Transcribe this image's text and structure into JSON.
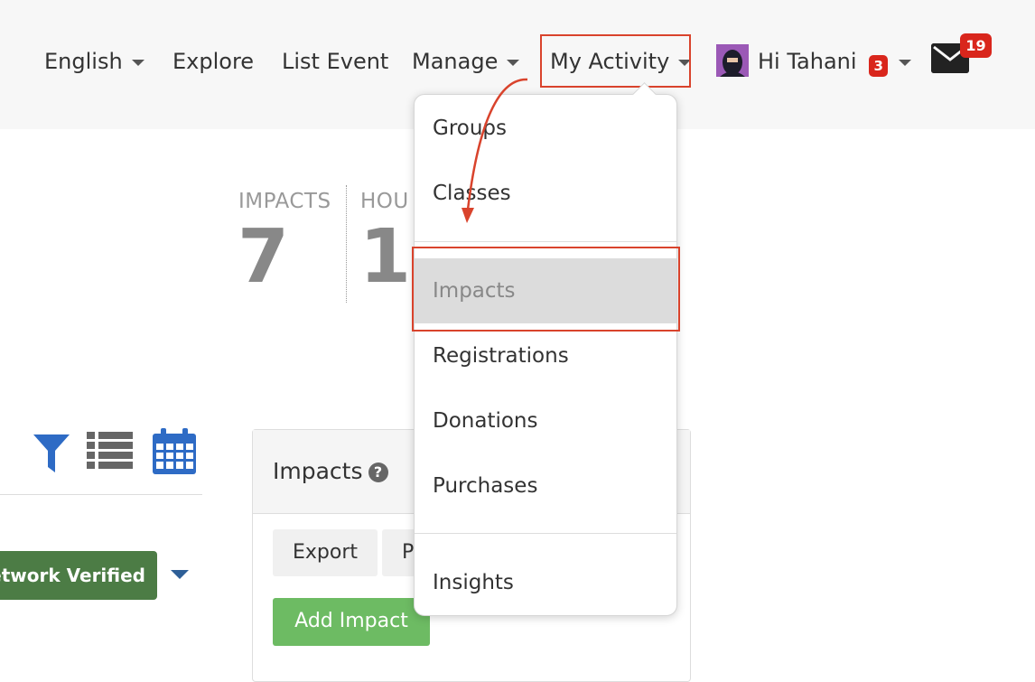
{
  "nav": {
    "language": "English",
    "explore": "Explore",
    "list_event": "List Event",
    "manage": "Manage",
    "my_activity": "My Activity",
    "greeting": "Hi Tahani",
    "greeting_badge": "3",
    "mail_badge": "19"
  },
  "stats": [
    {
      "label": "IMPACTS",
      "value": "7"
    },
    {
      "label": "HOU",
      "value": "1"
    }
  ],
  "filters": {
    "verified_label": "Network Verified"
  },
  "panel": {
    "title": "Impacts",
    "export_label": "Export",
    "second_button_label": "P",
    "add_label": "Add Impact"
  },
  "dropdown": {
    "items": [
      {
        "label": "Groups"
      },
      {
        "label": "Classes"
      },
      {
        "label": "Impacts"
      },
      {
        "label": "Registrations"
      },
      {
        "label": "Donations"
      },
      {
        "label": "Purchases"
      },
      {
        "label": "Insights"
      }
    ]
  },
  "colors": {
    "annotation": "#d9432c",
    "verified": "#4c7c45",
    "add_button": "#6dbb63",
    "badge": "#d9261c",
    "icon_blue": "#2e6bc5"
  }
}
